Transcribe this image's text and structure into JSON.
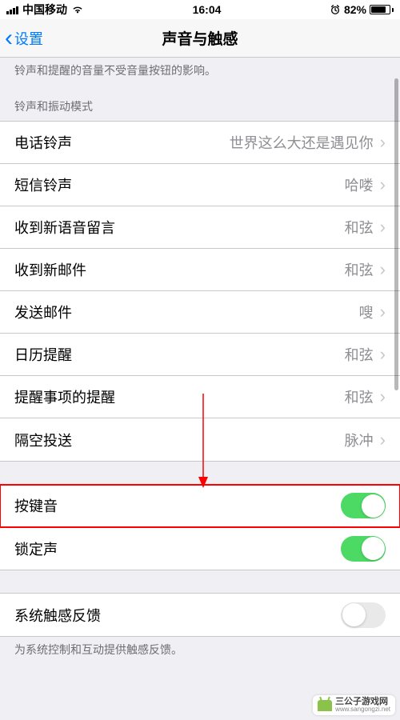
{
  "status": {
    "carrier": "中国移动",
    "time": "16:04",
    "battery_pct": "82%",
    "battery_fill_pct": 82
  },
  "nav": {
    "back_label": "设置",
    "title": "声音与触感"
  },
  "top_footer": "铃声和提醒的音量不受音量按钮的影响。",
  "section_header_1": "铃声和振动模式",
  "rows_sound": [
    {
      "label": "电话铃声",
      "value": "世界这么大还是遇见你"
    },
    {
      "label": "短信铃声",
      "value": "哈喽"
    },
    {
      "label": "收到新语音留言",
      "value": "和弦"
    },
    {
      "label": "收到新邮件",
      "value": "和弦"
    },
    {
      "label": "发送邮件",
      "value": "嗖"
    },
    {
      "label": "日历提醒",
      "value": "和弦"
    },
    {
      "label": "提醒事项的提醒",
      "value": "和弦"
    },
    {
      "label": "隔空投送",
      "value": "脉冲"
    }
  ],
  "rows_toggle1": [
    {
      "label": "按键音",
      "on": true
    },
    {
      "label": "锁定声",
      "on": true
    }
  ],
  "rows_toggle2": [
    {
      "label": "系统触感反馈",
      "on": false
    }
  ],
  "bottom_footer": "为系统控制和互动提供触感反馈。",
  "watermark": {
    "brand": "三公子游戏网",
    "url": "www.sangongzi.net"
  }
}
